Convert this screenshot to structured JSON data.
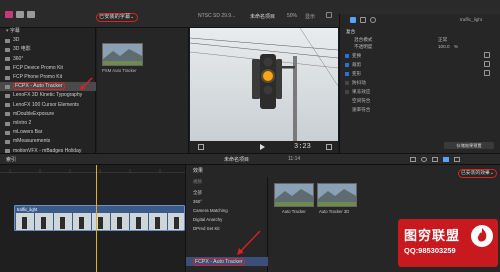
{
  "toolbar": {
    "library_filter": "已安装的字幕",
    "format": "NTSC SD 29.9...",
    "project_name": "未命名项目",
    "zoom": "显示",
    "zoom_value": "50%"
  },
  "sidebar": {
    "header": "字幕",
    "items": [
      {
        "label": "3D"
      },
      {
        "label": "3D 电影"
      },
      {
        "label": "360°"
      },
      {
        "label": "FCP Device Promo Kit"
      },
      {
        "label": "FCP Phone Promo Kit"
      },
      {
        "label": "FCPX - Auto Tracker"
      },
      {
        "label": "LenoFX 3D Kinetic Typography"
      },
      {
        "label": "LenoFX 100 Cursor Elements"
      },
      {
        "label": "mDoubleExposure"
      },
      {
        "label": "mIntro 2"
      },
      {
        "label": "mLowers Bar"
      },
      {
        "label": "mMeasurements"
      },
      {
        "label": "motionVFX - mBadges Holiday"
      }
    ]
  },
  "browser": {
    "clip_label": "PSM Auto Tracker"
  },
  "viewer": {
    "timecode": "3:23"
  },
  "inspector": {
    "clip_title": "traffic_light",
    "section_composite": "复合",
    "blend_label": "混合模式",
    "blend_value": "正常",
    "opacity_label": "不透明度",
    "opacity_value": "100.0",
    "opacity_unit": "%",
    "rows": [
      {
        "label": "变换",
        "checked": true
      },
      {
        "label": "裁剪",
        "checked": true
      },
      {
        "label": "变形",
        "checked": true
      },
      {
        "label": "防抖动",
        "checked": false
      },
      {
        "label": "果冻效应",
        "checked": false
      },
      {
        "label": "空间符合",
        "checked": false
      },
      {
        "label": "速率符合",
        "checked": false
      }
    ],
    "save_button": "存储效果预置"
  },
  "timeline_bar": {
    "index": "索引",
    "project_name": "未命名项目",
    "timecode": "11:14",
    "installed_effects": "已安装的效果"
  },
  "timeline": {
    "clip_name": "traffic_light"
  },
  "effects": {
    "header": "效果",
    "categories": [
      {
        "label": "视频"
      },
      {
        "label": "全部"
      },
      {
        "label": "360°"
      },
      {
        "label": "Camera Matching"
      },
      {
        "label": "Digital Anarchy"
      },
      {
        "label": "DPred Set Kit"
      },
      {
        "label": "FCPX - Auto Tracker"
      }
    ],
    "items": [
      {
        "label": "Auto Tracker"
      },
      {
        "label": "Auto Tracker 3D"
      }
    ]
  },
  "watermark": {
    "title": "图穷联盟",
    "qq": "QQ:985303259"
  }
}
